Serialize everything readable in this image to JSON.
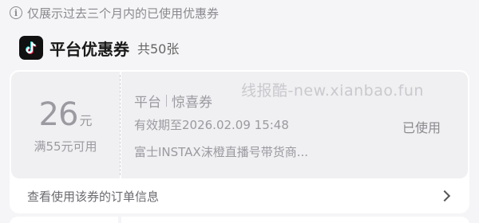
{
  "notice": {
    "icon": "info-icon",
    "text": "仅展示过去三个月内的已使用优惠券"
  },
  "header": {
    "logo": "tiktok-logo",
    "title": "平台优惠券",
    "count": "共50张"
  },
  "coupon": {
    "amount": "26",
    "unit": "元",
    "condition": "满55元可用",
    "type": "平台",
    "name": "惊喜券",
    "validity": "有效期至2026.02.09 15:48",
    "shop": "富士INSTAX沫橙直播号带货商...",
    "status": "已使用",
    "order_link": "查看使用该券的订单信息",
    "watermark": "线报酷-new.xianbao.fun"
  }
}
